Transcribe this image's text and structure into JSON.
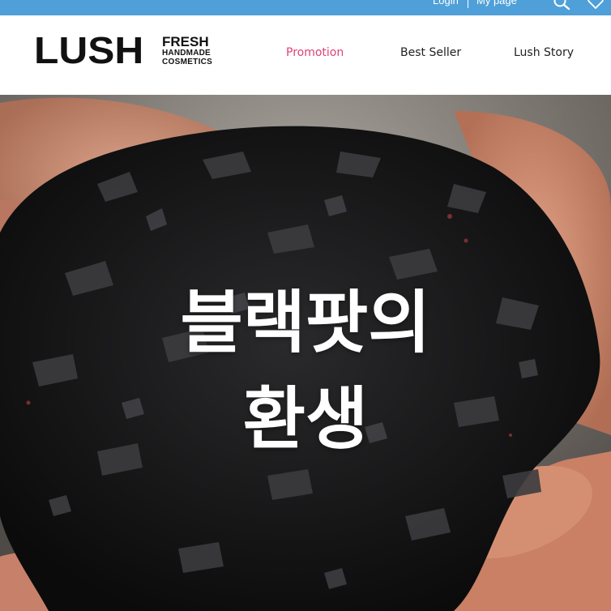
{
  "utility_bar": {
    "login_label": "Login",
    "mypage_label": "My page",
    "icons": [
      "search-icon",
      "heart-icon"
    ],
    "background": "#4fa0d8"
  },
  "logo": {
    "wordmark": "LUSH",
    "line1": "FRESH",
    "line2": "HANDMADE",
    "line3": "COSMETICS"
  },
  "nav": {
    "items": [
      {
        "label": "Promotion",
        "active": true,
        "color": "#e0407a"
      },
      {
        "label": "Best Seller",
        "active": false,
        "color": "#222222"
      },
      {
        "label": "Lush Story",
        "active": false,
        "color": "#222222"
      }
    ]
  },
  "hero": {
    "line1": "블랙팟의",
    "line2": "환생"
  }
}
